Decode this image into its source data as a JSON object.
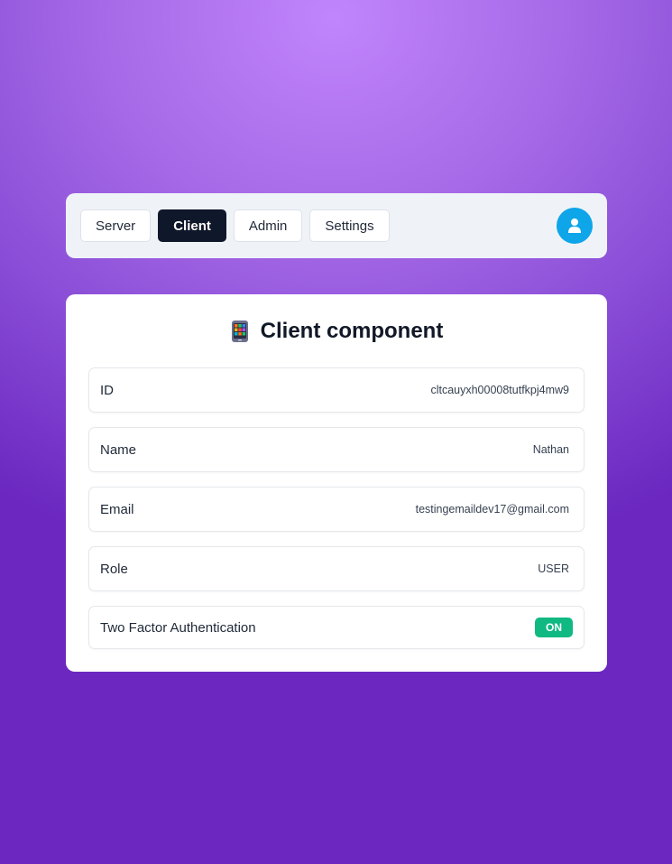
{
  "nav": {
    "items": [
      {
        "label": "Server",
        "active": false
      },
      {
        "label": "Client",
        "active": true
      },
      {
        "label": "Admin",
        "active": false
      },
      {
        "label": "Settings",
        "active": false
      }
    ],
    "avatar_icon": "user-icon",
    "avatar_color": "#0ea5e9"
  },
  "card": {
    "icon": "mobile-phone-icon",
    "title": "Client component",
    "rows": [
      {
        "label": "ID",
        "value": "cltcauyxh00008tutfkpj4mw9"
      },
      {
        "label": "Name",
        "value": "Nathan"
      },
      {
        "label": "Email",
        "value": "testingemaildev17@gmail.com"
      },
      {
        "label": "Role",
        "value": "USER"
      }
    ],
    "two_factor": {
      "label": "Two Factor Authentication",
      "status": "ON",
      "status_color": "#10b981"
    }
  }
}
